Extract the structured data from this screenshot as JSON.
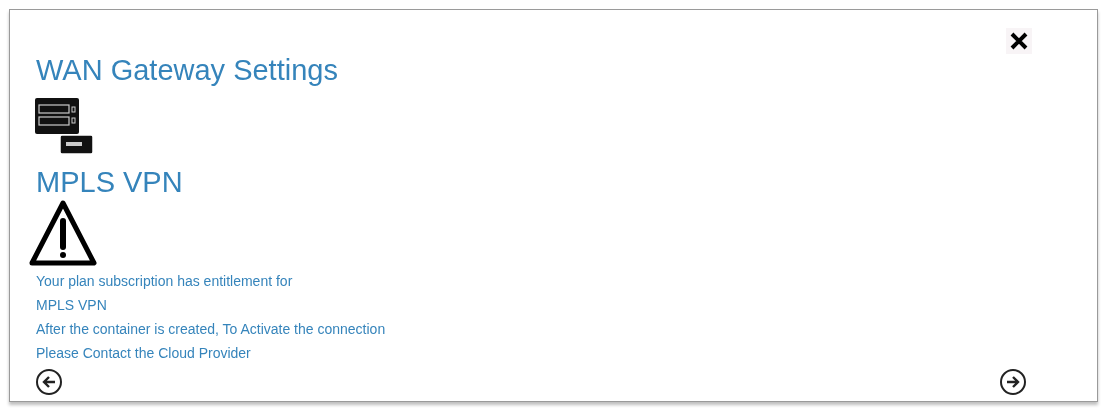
{
  "dialog": {
    "title": "WAN Gateway Settings",
    "section": "MPLS VPN",
    "messages": [
      "Your plan subscription has entitlement for",
      "MPLS VPN",
      "After the container is created, To Activate the connection",
      "Please Contact the Cloud Provider"
    ]
  }
}
